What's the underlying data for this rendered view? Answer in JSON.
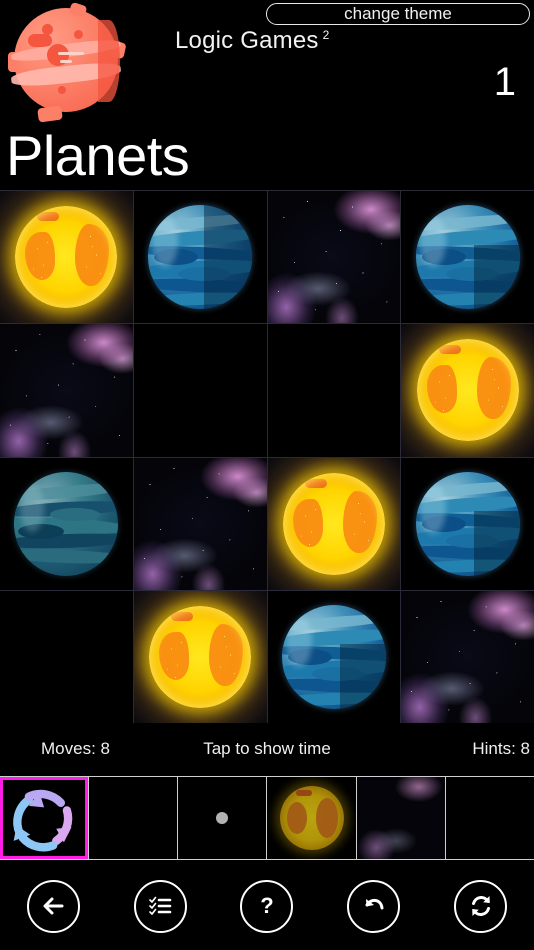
{
  "header": {
    "logo_icon": "red-planet-logo-icon",
    "app_title": "Logic Games",
    "app_title_sup": "2",
    "change_theme_label": "change theme",
    "level_number": "1",
    "board_title": "Planets"
  },
  "grid": {
    "columns": 4,
    "rows": 4,
    "cells": [
      {
        "type": "sun",
        "name": "grid-cell-sun"
      },
      {
        "type": "blue",
        "name": "grid-cell-blue-planet"
      },
      {
        "type": "empty",
        "name": "grid-cell-empty"
      },
      {
        "type": "blue",
        "name": "grid-cell-blue-planet"
      },
      {
        "type": "empty",
        "name": "grid-cell-empty"
      },
      {
        "type": "blank",
        "name": "grid-cell-blank"
      },
      {
        "type": "blank",
        "name": "grid-cell-blank"
      },
      {
        "type": "sun",
        "name": "grid-cell-sun"
      },
      {
        "type": "teal",
        "name": "grid-cell-teal-planet"
      },
      {
        "type": "empty",
        "name": "grid-cell-empty"
      },
      {
        "type": "sun",
        "name": "grid-cell-sun"
      },
      {
        "type": "blue",
        "name": "grid-cell-blue-planet"
      },
      {
        "type": "blank",
        "name": "grid-cell-blank"
      },
      {
        "type": "sun",
        "name": "grid-cell-sun"
      },
      {
        "type": "blue",
        "name": "grid-cell-blue-planet"
      },
      {
        "type": "empty",
        "name": "grid-cell-empty"
      }
    ]
  },
  "status": {
    "moves_label": "Moves: 8",
    "timer_label": "Tap to show time",
    "hints_label": "Hints: 8"
  },
  "tray": {
    "items": [
      {
        "name": "tray-item-rotate",
        "icon": "rotate-cycle-icon",
        "selected": true
      },
      {
        "name": "tray-item-empty-1",
        "icon": "empty",
        "selected": false
      },
      {
        "name": "tray-item-moon",
        "icon": "moon-dot-icon",
        "selected": false
      },
      {
        "name": "tray-item-sun",
        "icon": "sun-planet-icon",
        "selected": false
      },
      {
        "name": "tray-item-nebula",
        "icon": "nebula-icon",
        "selected": false
      },
      {
        "name": "tray-item-empty-2",
        "icon": "empty",
        "selected": false
      }
    ]
  },
  "toolbar": {
    "buttons": [
      {
        "name": "back-button",
        "icon": "arrow-left-icon"
      },
      {
        "name": "levels-button",
        "icon": "checklist-icon"
      },
      {
        "name": "help-button",
        "icon": "question-mark-icon"
      },
      {
        "name": "undo-button",
        "icon": "undo-arrow-icon"
      },
      {
        "name": "restart-button",
        "icon": "refresh-cycle-icon"
      }
    ]
  },
  "colors": {
    "background": "#000000",
    "accent_selected": "#ff1ee6",
    "sun": "#ffd400",
    "blue_planet": "#17639b",
    "teal_planet": "#1d5a72",
    "logo_planet": "#fc8068",
    "text": "#ffffff"
  }
}
